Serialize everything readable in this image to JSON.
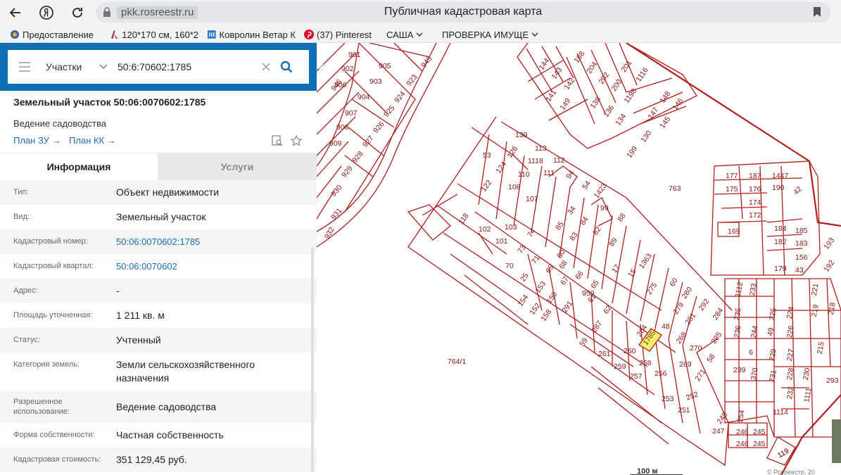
{
  "browser": {
    "url": "pkk.rosreestr.ru",
    "page_title": "Публичная кадастровая карта"
  },
  "bookmarks": [
    {
      "label": "Предоставление",
      "icon": "site-icon"
    },
    {
      "label": "120*170 см, 160*2",
      "icon": "site-icon"
    },
    {
      "label": "Ковролин Ветар К",
      "icon": "site-icon"
    },
    {
      "label": "(37) Pinterest",
      "icon": "pinterest-icon"
    },
    {
      "label": "САША",
      "icon": "folder"
    },
    {
      "label": "ПРОВЕРКА ИМУЩЕ",
      "icon": "folder"
    }
  ],
  "search": {
    "category": "Участки",
    "query": "50:6:70602:1785"
  },
  "object": {
    "title": "Земельный участок 50:06:0070602:1785",
    "subtitle": "Ведение садоводства",
    "plan_zu": "План ЗУ →",
    "plan_kk": "План КК →"
  },
  "tabs": {
    "info": "Информация",
    "services": "Услуги"
  },
  "attributes": [
    {
      "label": "Тип:",
      "value": "Объект недвижимости",
      "link": false
    },
    {
      "label": "Вид:",
      "value": "Земельный участок",
      "link": false
    },
    {
      "label": "Кадастровый номер:",
      "value": "50:06:0070602:1785",
      "link": true
    },
    {
      "label": "Кадастровый квартал:",
      "value": "50:06:0070602",
      "link": true
    },
    {
      "label": "Адрес:",
      "value": "-",
      "link": false
    },
    {
      "label": "Площадь уточненная:",
      "value": "1 211 кв. м",
      "link": false
    },
    {
      "label": "Статус:",
      "value": "Учтенный",
      "link": false
    },
    {
      "label": "Категория земель:",
      "value": "Земли сельскохозяйственного назначения",
      "link": false
    },
    {
      "label": "Разрешенное использование:",
      "value": "Ведение садоводства",
      "link": false
    },
    {
      "label": "Форма собственности:",
      "value": "Частная собственность",
      "link": false
    },
    {
      "label": "Кадастровая стоимость:",
      "value": "351 129,45 руб.",
      "link": false
    }
  ],
  "map": {
    "scale": "100 м",
    "copyright": "© Росреестр, 20",
    "highlight": "1785",
    "highlight_color": "#f5f06a",
    "line_color": "#b01e1e",
    "parcels": [
      "901",
      "902",
      "903",
      "904",
      "905",
      "906",
      "907",
      "908",
      "909",
      "923",
      "924",
      "925",
      "926",
      "927",
      "928",
      "929",
      "930",
      "931",
      "932",
      "945",
      "946",
      "144",
      "143",
      "142",
      "141",
      "149",
      "168",
      "204",
      "202",
      "200",
      "201",
      "1116",
      "1198",
      "136",
      "134",
      "138",
      "148",
      "146",
      "147",
      "145",
      "130",
      "199",
      "763",
      "139",
      "53",
      "126",
      "113",
      "112",
      "1118",
      "110",
      "111",
      "124",
      "122",
      "108",
      "107",
      "119",
      "94",
      "54",
      "1423",
      "99",
      "88",
      "118",
      "102",
      "103",
      "101",
      "74",
      "73",
      "71",
      "85",
      "34",
      "84",
      "82",
      "83",
      "89",
      "80",
      "69",
      "68",
      "67",
      "66",
      "65",
      "61",
      "62",
      "17",
      "15",
      "1363",
      "275",
      "60",
      "280",
      "279",
      "281",
      "292",
      "284",
      "285",
      "70",
      "25",
      "153",
      "154",
      "152",
      "150",
      "158",
      "291",
      "959",
      "287",
      "59",
      "48",
      "264",
      "268",
      "270",
      "269",
      "271",
      "58",
      "261",
      "260",
      "258",
      "256",
      "259",
      "257",
      "252",
      "253",
      "251",
      "248",
      "247",
      "764/1",
      "177",
      "187",
      "1447",
      "175",
      "176",
      "190",
      "42",
      "174",
      "172",
      "169",
      "184",
      "185",
      "182",
      "183",
      "156",
      "179",
      "43",
      "193",
      "192",
      "1112",
      "233",
      "235",
      "236",
      "244",
      "6",
      "239",
      "370",
      "225",
      "224",
      "226",
      "229",
      "231",
      "232",
      "1111",
      "1114",
      "49",
      "227",
      "228",
      "230",
      "221",
      "219",
      "218",
      "215",
      "293",
      "254",
      "246",
      "245",
      "119"
    ]
  }
}
